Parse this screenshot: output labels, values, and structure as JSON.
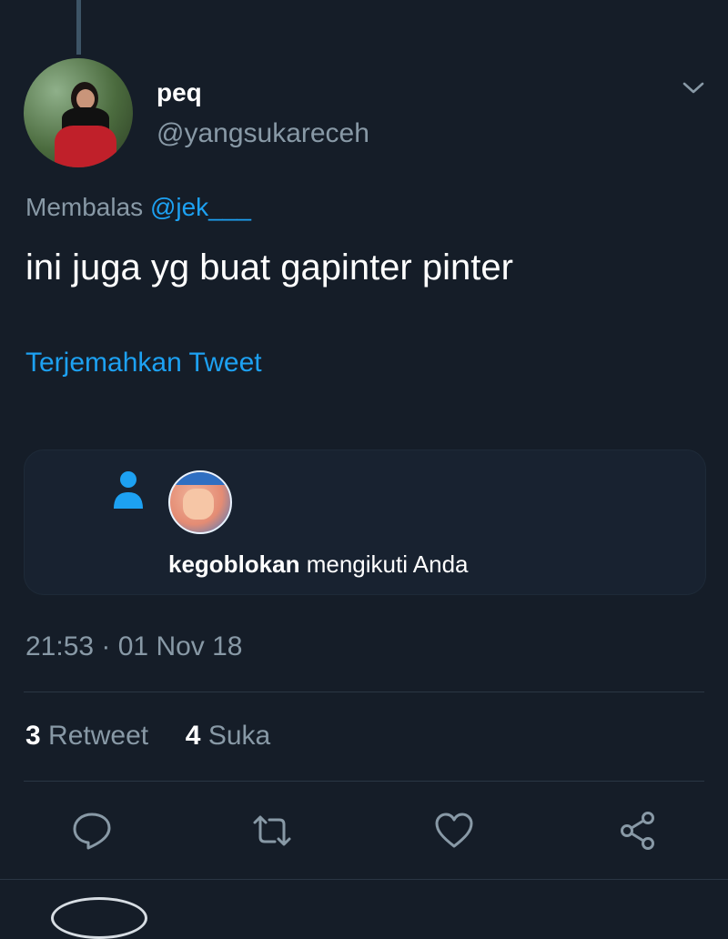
{
  "tweet": {
    "name": "peq",
    "handle": "@yangsukareceh",
    "reply_prefix": "Membalas",
    "reply_mention": "@jek___",
    "text": "ini juga yg buat gapinter pinter",
    "translate_label": "Terjemahkan Tweet",
    "timestamp": "21:53 · 01 Nov 18",
    "retweet_count": "3",
    "retweet_label": "Retweet",
    "like_count": "4",
    "like_label": "Suka"
  },
  "media_card": {
    "follower_name": "kegoblokan",
    "follow_text": "mengikuti Anda"
  },
  "icons": {
    "chevron": "chevron-down-icon",
    "person": "person-icon",
    "reply": "reply-icon",
    "retweet": "retweet-icon",
    "like": "heart-icon",
    "share": "share-icon"
  },
  "colors": {
    "background": "#151d28",
    "accent": "#1da1f2",
    "secondary_text": "#8899a6",
    "primary_text": "#ffffff"
  }
}
